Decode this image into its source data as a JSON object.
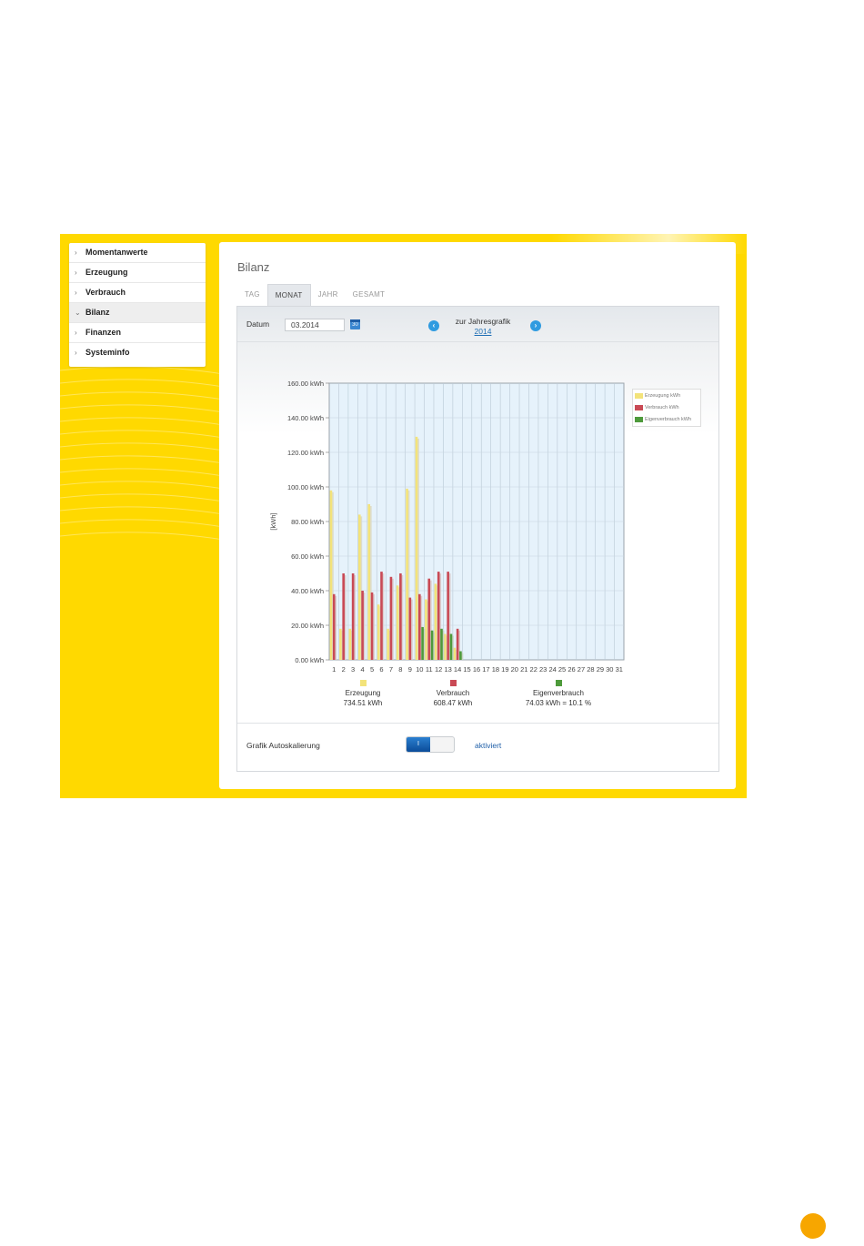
{
  "sidebar": {
    "items": [
      {
        "label": "Momentanwerte",
        "expanded": false
      },
      {
        "label": "Erzeugung",
        "expanded": false
      },
      {
        "label": "Verbrauch",
        "expanded": false
      },
      {
        "label": "Bilanz",
        "expanded": true
      },
      {
        "label": "Finanzen",
        "expanded": false
      },
      {
        "label": "Systeminfo",
        "expanded": false
      }
    ]
  },
  "panel": {
    "title": "Bilanz",
    "tabs": [
      "TAG",
      "MONAT",
      "JAHR",
      "GESAMT"
    ],
    "active_tab": "MONAT"
  },
  "toolbar": {
    "datum_label": "Datum",
    "datum_value": "03.2014",
    "calendar_icon": "calendar-icon",
    "year_nav_title": "zur Jahresgrafik",
    "year_nav_link": "2014",
    "prev_icon": "arrow-left-icon",
    "next_icon": "arrow-right-icon"
  },
  "chart_data": {
    "type": "bar",
    "ylabel": "[kWh]",
    "ylim": [
      0,
      160
    ],
    "yticks": [
      "0.00 kWh",
      "20.00 kWh",
      "40.00 kWh",
      "60.00 kWh",
      "80.00 kWh",
      "100.00 kWh",
      "120.00 kWh",
      "140.00 kWh",
      "160.00 kWh"
    ],
    "categories": [
      "1",
      "2",
      "3",
      "4",
      "5",
      "6",
      "7",
      "8",
      "9",
      "10",
      "11",
      "12",
      "13",
      "14",
      "15",
      "16",
      "17",
      "18",
      "19",
      "20",
      "21",
      "22",
      "23",
      "24",
      "25",
      "26",
      "27",
      "28",
      "29",
      "30",
      "31"
    ],
    "grid": true,
    "legend_placement": "top-right",
    "series": [
      {
        "name": "Erzeugung kWh",
        "color": "#f3e37a",
        "values": [
          98,
          18,
          18,
          84,
          90,
          32,
          18,
          43,
          99,
          129,
          35,
          44,
          15,
          7,
          null,
          null,
          null,
          null,
          null,
          null,
          null,
          null,
          null,
          null,
          null,
          null,
          null,
          null,
          null,
          null,
          null
        ]
      },
      {
        "name": "Verbrauch kWh",
        "color": "#c94a55",
        "values": [
          38,
          50,
          50,
          40,
          39,
          51,
          48,
          50,
          36,
          38,
          47,
          51,
          51,
          18,
          null,
          null,
          null,
          null,
          null,
          null,
          null,
          null,
          null,
          null,
          null,
          null,
          null,
          null,
          null,
          null,
          null
        ]
      },
      {
        "name": "Eigenverbrauch kWh",
        "color": "#4e9a3b",
        "values": [
          null,
          null,
          null,
          null,
          null,
          null,
          null,
          null,
          null,
          19,
          17,
          18,
          15,
          5,
          null,
          null,
          null,
          null,
          null,
          null,
          null,
          null,
          null,
          null,
          null,
          null,
          null,
          null,
          null,
          null,
          null
        ]
      }
    ],
    "summary": [
      {
        "label": "Erzeugung",
        "value": "734.51 kWh",
        "color": "#f3e37a"
      },
      {
        "label": "Verbrauch",
        "value": "608.47 kWh",
        "color": "#c94a55"
      },
      {
        "label": "Eigenverbrauch",
        "value": "74.03 kWh = 10.1 %",
        "color": "#4e9a3b"
      }
    ]
  },
  "autoscale": {
    "label": "Grafik Autoskalierung",
    "toggle_text": "I",
    "status": "aktiviert"
  }
}
